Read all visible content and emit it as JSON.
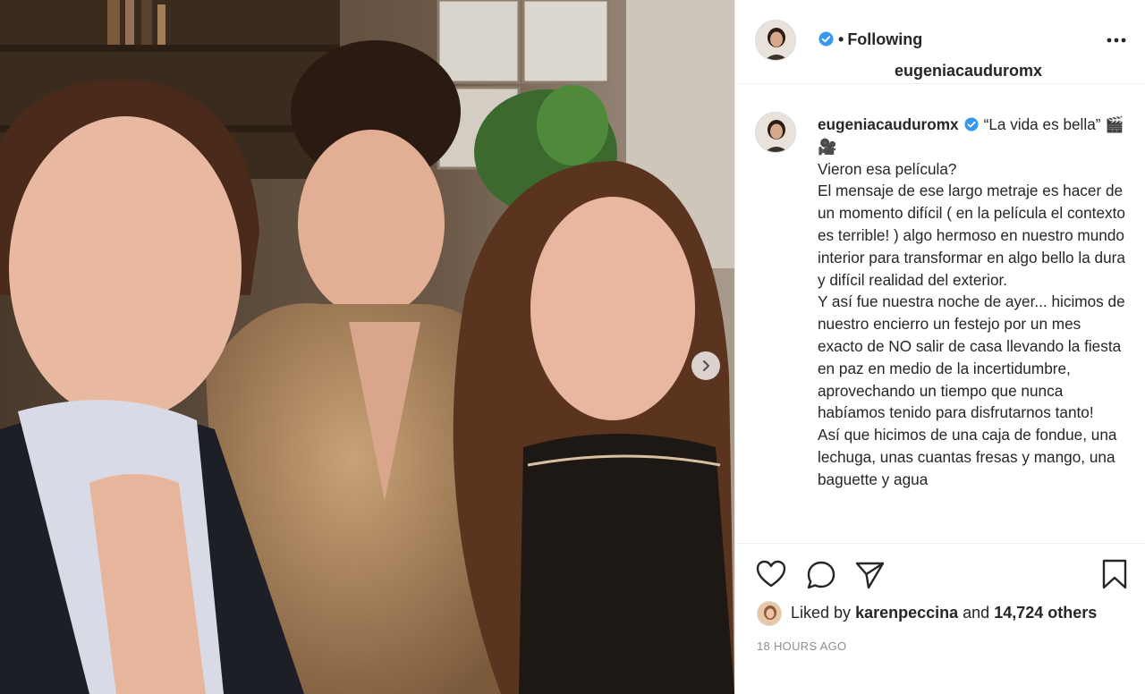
{
  "post": {
    "username": "eugeniacauduromx",
    "follow_status": "Following",
    "follow_separator": "•",
    "caption_lines": [
      "“La vida es bella” 🎬🎥",
      "Vieron esa película?",
      "El mensaje de ese largo metraje es hacer de un momento difícil ( en la película el contexto es terrible! ) algo hermoso en nuestro mundo interior para transformar en algo bello la dura y difícil realidad del exterior.",
      "Y así fue nuestra noche de ayer... hicimos de nuestro encierro un festejo por un mes exacto de NO salir de casa llevando la fiesta en paz en medio de la incertidumbre, aprovechando un tiempo que nunca habíamos tenido para disfrutarnos tanto!",
      "Así que hicimos de una caja de fondue, una lechuga, unas cuantas fresas y mango, una baguette y agua"
    ],
    "liked_by_prefix": "Liked by",
    "liked_by_user": "karenpeccina",
    "liked_by_and": "and",
    "liked_by_others": "14,724 others",
    "timestamp": "18 hours ago"
  },
  "icons": {
    "verified": "verified-badge-icon",
    "more": "more-options-icon",
    "like": "heart-icon",
    "comment": "comment-icon",
    "share": "paper-plane-icon",
    "save": "bookmark-icon",
    "next": "chevron-right-icon"
  },
  "colors": {
    "verified_blue": "#3897f0",
    "text": "#262626",
    "muted": "#8e8e8e",
    "border": "#efefef"
  }
}
